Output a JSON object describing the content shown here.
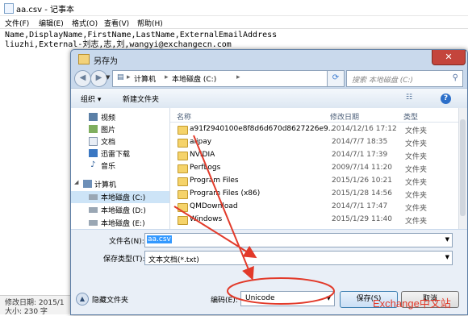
{
  "notepad": {
    "title": "aa.csv - 记事本",
    "menu": [
      "文件(F)",
      "编辑(E)",
      "格式(O)",
      "查看(V)",
      "帮助(H)"
    ],
    "content_line1": "Name,DisplayName,FirstName,LastName,ExternalEmailAddress",
    "content_line2": "liuzhi,External-刘志,志,刘,wangyi@exchangecn.com",
    "status_line1": "修改日期: 2015/1",
    "status_line2": "大小: 230 字"
  },
  "dialog": {
    "title": "另存为",
    "close_label": "✕",
    "breadcrumb": [
      "计算机",
      "本地磁盘 (C:)"
    ],
    "search_placeholder": "搜索 本地磁盘 (C:)",
    "toolbar": {
      "organize": "组织 ▾",
      "new_folder": "新建文件夹"
    },
    "nav_items": [
      {
        "label": "视频",
        "icon": "video-icon"
      },
      {
        "label": "图片",
        "icon": "pictures-icon"
      },
      {
        "label": "文档",
        "icon": "documents-icon"
      },
      {
        "label": "迅雷下载",
        "icon": "download-icon"
      },
      {
        "label": "音乐",
        "icon": "music-icon"
      },
      {
        "label": "计算机",
        "icon": "computer-icon"
      },
      {
        "label": "本地磁盘 (C:)",
        "icon": "drive-icon"
      },
      {
        "label": "本地磁盘 (D:)",
        "icon": "drive-icon"
      },
      {
        "label": "本地磁盘 (E:)",
        "icon": "drive-icon"
      }
    ],
    "columns": {
      "name": "名称",
      "date": "修改日期",
      "type": "类型"
    },
    "files": [
      {
        "name": "a91f2940100e8f8d6d670d8627226e9...",
        "date": "2014/12/16 17:12",
        "type": "文件夹"
      },
      {
        "name": "alipay",
        "date": "2014/7/7 18:35",
        "type": "文件夹"
      },
      {
        "name": "NVIDIA",
        "date": "2014/7/1 17:39",
        "type": "文件夹"
      },
      {
        "name": "PerfLogs",
        "date": "2009/7/14 11:20",
        "type": "文件夹"
      },
      {
        "name": "Program Files",
        "date": "2015/1/26 10:21",
        "type": "文件夹"
      },
      {
        "name": "Program Files (x86)",
        "date": "2015/1/28 14:56",
        "type": "文件夹"
      },
      {
        "name": "QMDownload",
        "date": "2014/7/1 17:47",
        "type": "文件夹"
      },
      {
        "name": "Windows",
        "date": "2015/1/29 11:40",
        "type": "文件夹"
      }
    ],
    "filename_label": "文件名(N):",
    "filename_value": "aa.csv",
    "filetype_label": "保存类型(T):",
    "filetype_value": "文本文档(*.txt)",
    "hide_folders": "隐藏文件夹",
    "encoding_label": "编码(E):",
    "encoding_value": "Unicode",
    "save_label": "保存(S)",
    "cancel_label": "取消"
  },
  "watermark": "Exchange中文站",
  "colors": {
    "annotation": "#e23a2a",
    "accent": "#3399ff"
  }
}
